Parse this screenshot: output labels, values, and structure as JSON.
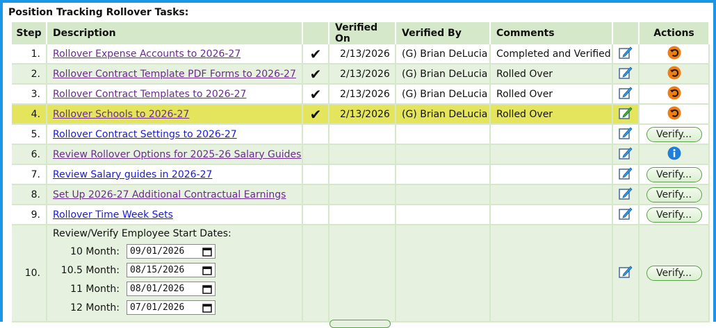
{
  "panel": {
    "title": "Position Tracking Rollover Tasks:"
  },
  "columns": {
    "step": "Step",
    "description": "Description",
    "verified_on": "Verified On",
    "verified_by": "Verified By",
    "comments": "Comments",
    "actions": "Actions"
  },
  "rows": [
    {
      "step": "1.",
      "description": "Rollover Expense Accounts to 2026-27",
      "checked": "✔",
      "verified_on": "2/13/2026",
      "verified_by": "(G) Brian DeLucia",
      "comments": "Completed and Verified",
      "action": "undo"
    },
    {
      "step": "2.",
      "description": "Rollover Contract Template PDF Forms to 2026-27",
      "checked": "✔",
      "verified_on": "2/13/2026",
      "verified_by": "(G) Brian DeLucia",
      "comments": "Rolled Over",
      "action": "undo"
    },
    {
      "step": "3.",
      "description": "Rollover Contract Templates to 2026-27",
      "checked": "✔",
      "verified_on": "2/13/2026",
      "verified_by": "(G) Brian DeLucia",
      "comments": "Rolled Over",
      "action": "undo"
    },
    {
      "step": "4.",
      "description": "Rollover Schools to 2026-27",
      "checked": "✔",
      "verified_on": "2/13/2026",
      "verified_by": "(G) Brian DeLucia",
      "comments": "Rolled Over",
      "action": "undo"
    },
    {
      "step": "5.",
      "description": "Rollover Contract Settings to 2026-27",
      "action_label": "Verify..."
    },
    {
      "step": "6.",
      "description": "Review Rollover Options for 2025-26 Salary Guides",
      "action": "info"
    },
    {
      "step": "7.",
      "description": "Review Salary guides in 2026-27",
      "action_label": "Verify..."
    },
    {
      "step": "8.",
      "description": "Set Up 2026-27 Additional Contractual Earnings",
      "action_label": "Verify..."
    },
    {
      "step": "9.",
      "description": "Rollover Time Week Sets",
      "action_label": "Verify..."
    },
    {
      "step": "10.",
      "description": "Review/Verify Employee Start Dates:",
      "action_label": "Verify..."
    }
  ],
  "start_dates": [
    {
      "label": "10 Month:",
      "value": "09/01/2026"
    },
    {
      "label": "10.5 Month:",
      "value": "08/15/2026"
    },
    {
      "label": "11 Month:",
      "value": "08/01/2026"
    },
    {
      "label": "12 Month:",
      "value": "07/01/2026"
    }
  ],
  "colors": {
    "frame": "#1b95e8",
    "header_bg": "#d5e8c9",
    "row_alt": "#e6f2df",
    "highlight": "#e4e55c",
    "link_visited": "#6a2a8e",
    "link": "#1a1ad6",
    "undo": "#f07c14",
    "info": "#1f7fd6"
  },
  "icons": {
    "edit": "edit-icon",
    "undo": "undo-icon",
    "info": "info-icon",
    "calendar": "calendar-icon",
    "check": "checkmark-icon"
  }
}
